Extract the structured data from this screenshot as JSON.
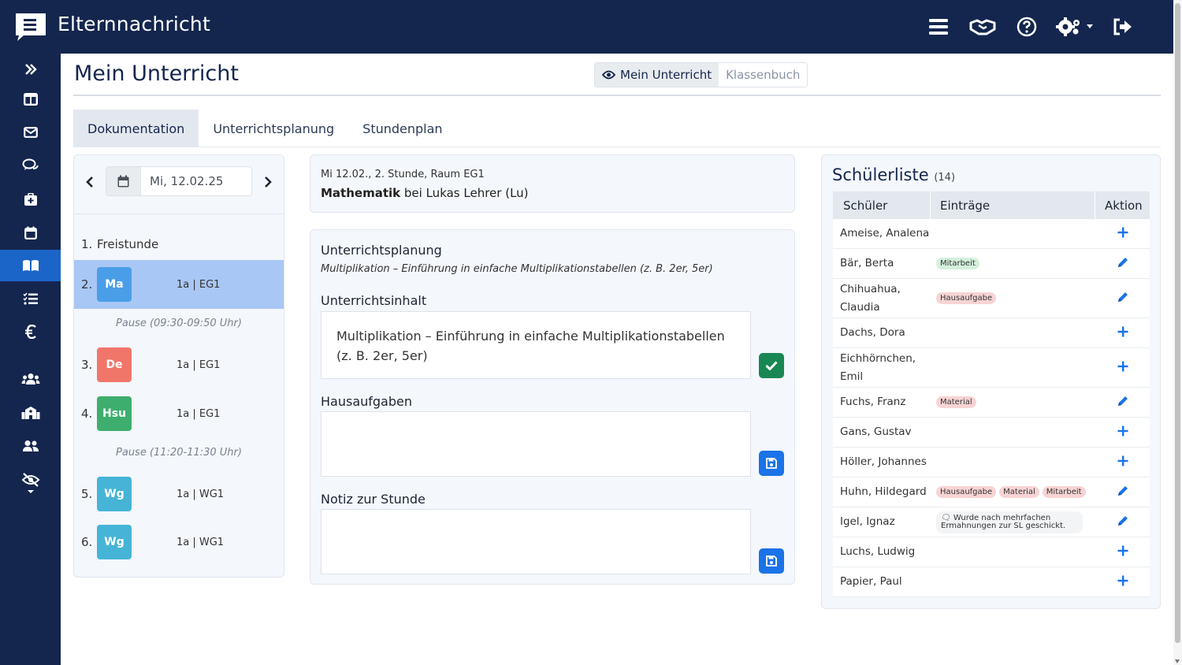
{
  "app": {
    "title": "Elternnachricht"
  },
  "page": {
    "title": "Mein Unterricht"
  },
  "view_toggle": {
    "mine": "Mein Unterricht",
    "classbook": "Klassenbuch"
  },
  "tabs": [
    "Dokumentation",
    "Unterrichtsplanung",
    "Stundenplan"
  ],
  "date_nav": {
    "value": "Mi, 12.02.25"
  },
  "lessons": [
    {
      "num": "1.",
      "label": "Freistunde"
    },
    {
      "num": "2.",
      "badge": "Ma",
      "color": "#4a9ee8",
      "cls": "1a | EG1",
      "active": true
    },
    {
      "num": "3.",
      "badge": "De",
      "color": "#f0766a",
      "cls": "1a | EG1"
    },
    {
      "num": "4.",
      "badge": "Hsu",
      "color": "#3dae6e",
      "cls": "1a | EG1"
    },
    {
      "num": "5.",
      "badge": "Wg",
      "color": "#46b4d6",
      "cls": "1a | WG1"
    },
    {
      "num": "6.",
      "badge": "Wg",
      "color": "#46b4d6",
      "cls": "1a | WG1"
    }
  ],
  "pauses": [
    "Pause (09:30-09:50 Uhr)",
    "Pause (11:20-11:30 Uhr)"
  ],
  "lesson_info": {
    "meta": "Mi 12.02., 2. Stunde, Raum EG1",
    "subject": "Mathematik",
    "teacher": "bei Lukas Lehrer (Lu)"
  },
  "documentation": {
    "planning_title": "Unterrichtsplanung",
    "planning_text": "Multiplikation – Einführung in einfache Multiplikationstabellen (z. B. 2er, 5er)",
    "content_title": "Unterrichtsinhalt",
    "content_text": "Multiplikation – Einführung in einfache Multiplikationstabellen (z. B. 2er, 5er)",
    "homework_title": "Hausaufgaben",
    "homework_text": "",
    "note_title": "Notiz zur Stunde",
    "note_text": ""
  },
  "students": {
    "title": "Schülerliste",
    "count": "(14)",
    "columns": [
      "Schüler",
      "Einträge",
      "Aktion"
    ],
    "rows": [
      {
        "name": "Ameise, Analena",
        "entries": [],
        "action": "add"
      },
      {
        "name": "Bär, Berta",
        "entries": [
          {
            "label": "Mitarbeit",
            "tone": "green"
          }
        ],
        "action": "edit"
      },
      {
        "name": "Chihuahua, Claudia",
        "entries": [
          {
            "label": "Hausaufgabe",
            "tone": "red"
          }
        ],
        "action": "edit"
      },
      {
        "name": "Dachs, Dora",
        "entries": [],
        "action": "add"
      },
      {
        "name": "Eichhörnchen, Emil",
        "entries": [],
        "action": "add"
      },
      {
        "name": "Fuchs, Franz",
        "entries": [
          {
            "label": "Material",
            "tone": "red"
          }
        ],
        "action": "edit"
      },
      {
        "name": "Gans, Gustav",
        "entries": [],
        "action": "add"
      },
      {
        "name": "Höller, Johannes",
        "entries": [],
        "action": "add"
      },
      {
        "name": "Huhn, Hildegard",
        "entries": [
          {
            "label": "Hausaufgabe",
            "tone": "red"
          },
          {
            "label": "Material",
            "tone": "red"
          },
          {
            "label": "Mitarbeit",
            "tone": "red"
          }
        ],
        "action": "edit"
      },
      {
        "name": "Igel, Ignaz",
        "note": "Wurde nach mehrfachen Ermahnungen zur SL geschickt.",
        "entries": [],
        "action": "edit"
      },
      {
        "name": "Luchs, Ludwig",
        "entries": [],
        "action": "add"
      },
      {
        "name": "Papier, Paul",
        "entries": [],
        "action": "add"
      }
    ]
  },
  "colors": {
    "navy": "#14264e",
    "active_blue": "#1b64c8",
    "accent": "#1a73e8",
    "success": "#198754"
  },
  "icons": {
    "top": [
      "list-icon",
      "handshake-icon",
      "help-icon",
      "settings-icon",
      "logout-icon"
    ],
    "sidebar": [
      "expand-icon",
      "dashboard-icon",
      "mail-icon",
      "chat-icon",
      "medical-icon",
      "calendar-icon",
      "book-icon",
      "tasks-icon",
      "euro-icon",
      "users-icon",
      "school-icon",
      "group-icon",
      "hidden-icon"
    ]
  }
}
